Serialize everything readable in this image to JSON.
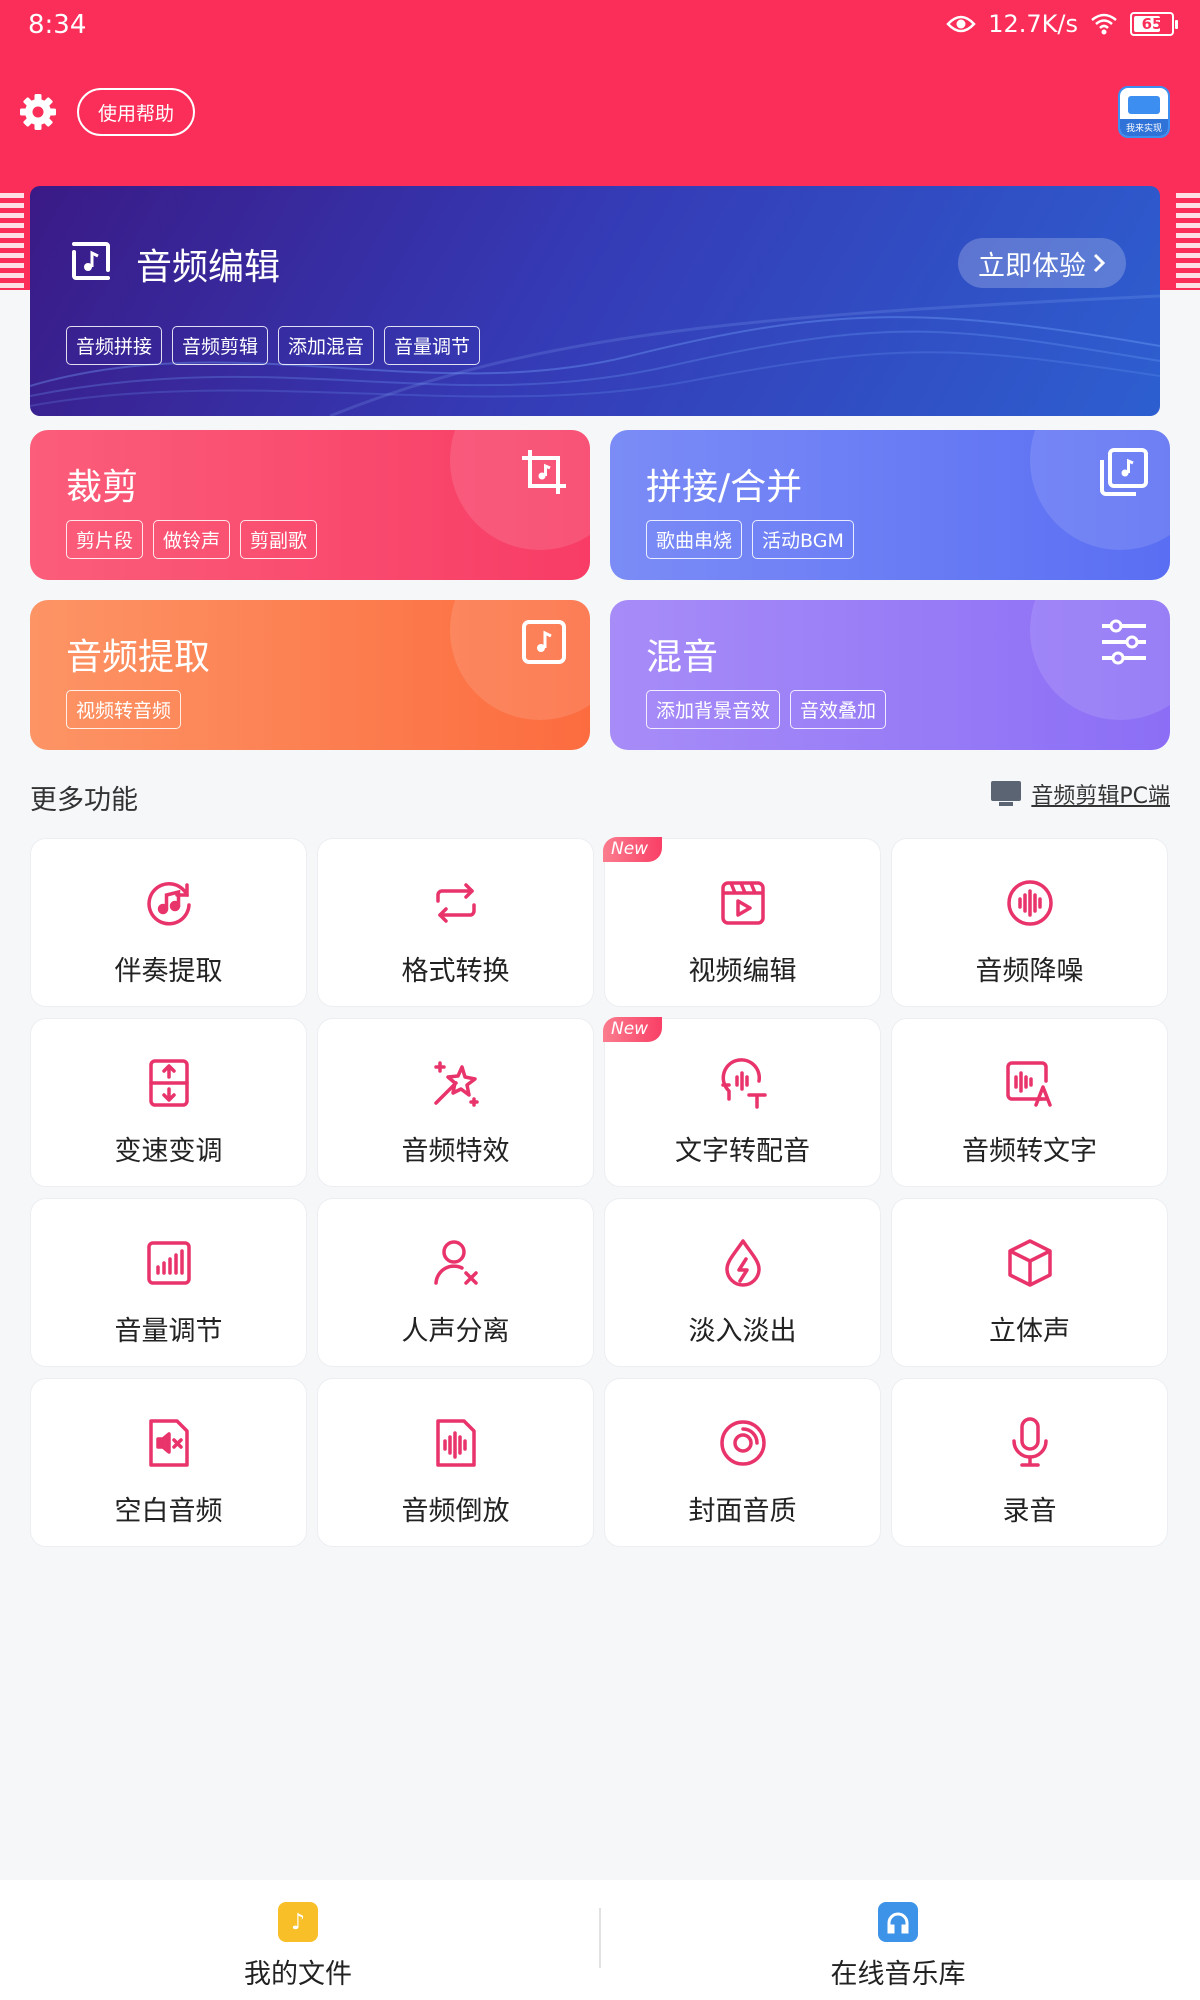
{
  "status_bar": {
    "time": "8:34",
    "speed": "12.7K/s",
    "battery": "65"
  },
  "header": {
    "help_label": "使用帮助",
    "pc_badge_label": "我来实现"
  },
  "banner": {
    "title": "音频编辑",
    "cta": "立即体验",
    "tags": [
      "音频拼接",
      "音频剪辑",
      "添加混音",
      "音量调节"
    ]
  },
  "cards": {
    "cut": {
      "title": "裁剪",
      "tags": [
        "剪片段",
        "做铃声",
        "剪副歌"
      ]
    },
    "join": {
      "title": "拼接/合并",
      "tags": [
        "歌曲串烧",
        "活动BGM"
      ]
    },
    "extract": {
      "title": "音频提取",
      "tags": [
        "视频转音频"
      ]
    },
    "mix": {
      "title": "混音",
      "tags": [
        "添加背景音效",
        "音效叠加"
      ]
    }
  },
  "more": {
    "title": "更多功能",
    "pc_link": "音频剪辑PC端"
  },
  "tiles": [
    {
      "label": "伴奏提取",
      "icon": "accompaniment-extract-icon"
    },
    {
      "label": "格式转换",
      "icon": "format-convert-icon"
    },
    {
      "label": "视频编辑",
      "icon": "video-edit-icon",
      "badge": "New"
    },
    {
      "label": "音频降噪",
      "icon": "noise-reduction-icon"
    },
    {
      "label": "变速变调",
      "icon": "speed-pitch-icon"
    },
    {
      "label": "音频特效",
      "icon": "magic-wand-icon"
    },
    {
      "label": "文字转配音",
      "icon": "text-to-speech-icon",
      "badge": "New"
    },
    {
      "label": "音频转文字",
      "icon": "speech-to-text-icon"
    },
    {
      "label": "音量调节",
      "icon": "volume-bars-icon"
    },
    {
      "label": "人声分离",
      "icon": "vocal-separate-icon"
    },
    {
      "label": "淡入淡出",
      "icon": "fade-drop-icon"
    },
    {
      "label": "立体声",
      "icon": "cube-icon"
    },
    {
      "label": "空白音频",
      "icon": "silent-audio-icon"
    },
    {
      "label": "音频倒放",
      "icon": "audio-reverse-icon"
    },
    {
      "label": "封面音质",
      "icon": "disc-icon"
    },
    {
      "label": "录音",
      "icon": "microphone-icon"
    }
  ],
  "bottom_nav": {
    "files": "我的文件",
    "library": "在线音乐库"
  },
  "colors": {
    "brand": "#fb2d59",
    "icon_pink": "#e8336b"
  }
}
